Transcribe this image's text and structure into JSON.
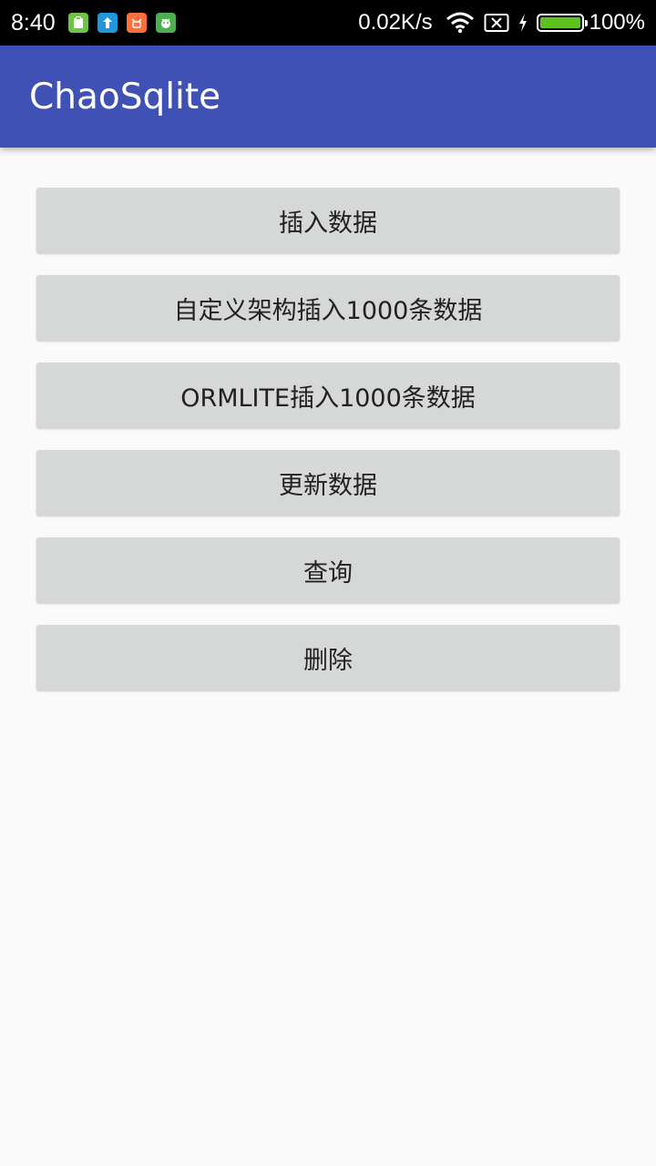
{
  "status_bar": {
    "time": "8:40",
    "network_speed": "0.02K/s",
    "battery_percent": "100%",
    "battery_level": 1.0,
    "notification_icons": [
      {
        "name": "clipboard-icon",
        "color": "#6cc644"
      },
      {
        "name": "upload-icon",
        "color": "#2196d8"
      },
      {
        "name": "mi-icon",
        "color": "#ff6f3c"
      },
      {
        "name": "android-face-icon",
        "color": "#4caf50"
      }
    ],
    "colors": {
      "battery_fill": "#5ec21e"
    }
  },
  "app_bar": {
    "title": "ChaoSqlite",
    "color": "#3f51b5"
  },
  "buttons": [
    {
      "label": "插入数据"
    },
    {
      "label": "自定义架构插入1000条数据"
    },
    {
      "label": "ORMLITE插入1000条数据"
    },
    {
      "label": "更新数据"
    },
    {
      "label": "查询"
    },
    {
      "label": "删除"
    }
  ]
}
